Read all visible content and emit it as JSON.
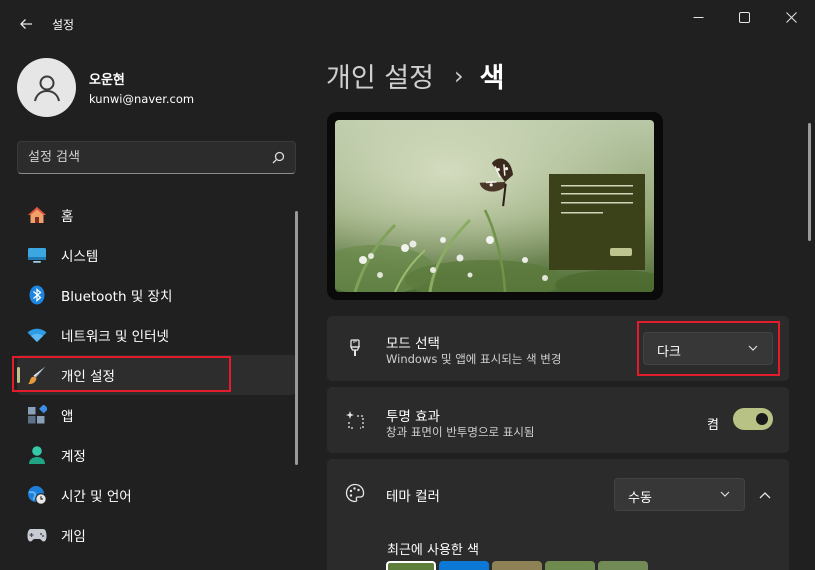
{
  "window": {
    "app_title": "설정",
    "back_icon": "back-arrow-icon",
    "minimize_icon": "minimize-icon",
    "maximize_icon": "maximize-icon",
    "close_icon": "close-icon"
  },
  "profile": {
    "name": "오운현",
    "email": "kunwi@naver.com",
    "avatar_icon": "person-icon"
  },
  "search": {
    "placeholder": "설정 검색",
    "icon": "search-icon"
  },
  "sidebar": {
    "items": [
      {
        "label": "홈",
        "icon": "home-icon",
        "active": false
      },
      {
        "label": "시스템",
        "icon": "monitor-icon",
        "active": false
      },
      {
        "label": "Bluetooth 및 장치",
        "icon": "bluetooth-icon",
        "active": false
      },
      {
        "label": "네트워크 및 인터넷",
        "icon": "wifi-icon",
        "active": false
      },
      {
        "label": "개인 설정",
        "icon": "paintbrush-icon",
        "active": true
      },
      {
        "label": "앱",
        "icon": "apps-icon",
        "active": false
      },
      {
        "label": "계정",
        "icon": "account-icon",
        "active": false
      },
      {
        "label": "시간 및 언어",
        "icon": "globe-clock-icon",
        "active": false
      },
      {
        "label": "게임",
        "icon": "gamepad-icon",
        "active": false
      }
    ]
  },
  "breadcrumb": {
    "parent": "개인 설정",
    "separator": "›",
    "current": "색"
  },
  "preview": {
    "image": "butterfly-wallpaper",
    "window_color": "#3b4119"
  },
  "mode_card": {
    "title": "모드 선택",
    "description": "Windows 및 앱에 표시되는 색 변경",
    "icon": "brush-icon",
    "selected": "다크"
  },
  "transparency_card": {
    "title": "투명 효과",
    "description": "창과 표면이 반투명으로 표시됨",
    "icon": "transparency-sparkle-icon",
    "state_label": "켬",
    "on": true
  },
  "accent_card": {
    "title": "테마 컬러",
    "icon": "palette-icon",
    "selected": "수동",
    "expanded": true
  },
  "recent_colors": {
    "title": "최근에 사용한 색",
    "swatches": [
      "#5e7e3c",
      "#0a78d4",
      "#8d8155",
      "#6e8a4e",
      "#728a55"
    ]
  },
  "colors": {
    "accent": "#b7c284",
    "highlight_outline": "#e21c2a"
  }
}
